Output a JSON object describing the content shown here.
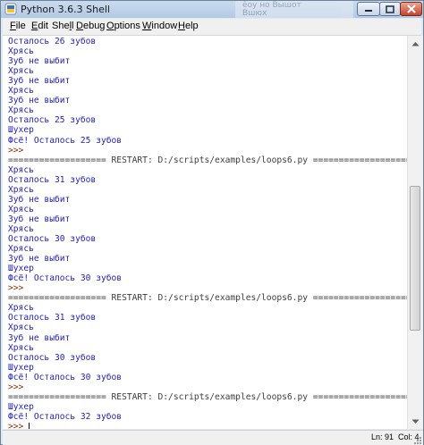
{
  "window": {
    "title": "Python 3.6.3 Shell",
    "background_window_text": [
      "ёоу но Вышот",
      "Вшюх"
    ]
  },
  "menu": {
    "items": [
      {
        "label": "File",
        "underline": "F",
        "rest": "ile"
      },
      {
        "label": "Edit",
        "underline": "E",
        "rest": "dit"
      },
      {
        "label": "Shell",
        "underline": "",
        "pre": "She",
        "underline_mid": "l",
        "rest": "l"
      },
      {
        "label": "Debug",
        "underline": "D",
        "rest": "ebug"
      },
      {
        "label": "Options",
        "underline": "O",
        "rest": "ptions"
      },
      {
        "label": "Window",
        "underline": "W",
        "rest": "indow"
      },
      {
        "label": "Help",
        "underline": "H",
        "rest": "elp"
      }
    ]
  },
  "shell": {
    "lines": [
      {
        "text": "Осталось 26 зубов",
        "kind": "out"
      },
      {
        "text": "Хрясь",
        "kind": "out"
      },
      {
        "text": "Зуб не выбит",
        "kind": "out"
      },
      {
        "text": "Хрясь",
        "kind": "out"
      },
      {
        "text": "Зуб не выбит",
        "kind": "out"
      },
      {
        "text": "Хрясь",
        "kind": "out"
      },
      {
        "text": "Зуб не выбит",
        "kind": "out"
      },
      {
        "text": "Хрясь",
        "kind": "out"
      },
      {
        "text": "Осталось 25 зубов",
        "kind": "out"
      },
      {
        "text": "Шухер",
        "kind": "out"
      },
      {
        "text": "Фсё! Осталось 25 зубов",
        "kind": "out"
      },
      {
        "text": ">>>",
        "kind": "prompt"
      },
      {
        "text": "=================== RESTART: D:/scripts/examples/loops6.py ===================",
        "kind": "restart"
      },
      {
        "text": "Хрясь",
        "kind": "out"
      },
      {
        "text": "Осталось 31 зубов",
        "kind": "out"
      },
      {
        "text": "Хрясь",
        "kind": "out"
      },
      {
        "text": "Зуб не выбит",
        "kind": "out"
      },
      {
        "text": "Хрясь",
        "kind": "out"
      },
      {
        "text": "Зуб не выбит",
        "kind": "out"
      },
      {
        "text": "Хрясь",
        "kind": "out"
      },
      {
        "text": "Осталось 30 зубов",
        "kind": "out"
      },
      {
        "text": "Хрясь",
        "kind": "out"
      },
      {
        "text": "Зуб не выбит",
        "kind": "out"
      },
      {
        "text": "Шухер",
        "kind": "out"
      },
      {
        "text": "Фсё! Осталось 30 зубов",
        "kind": "out"
      },
      {
        "text": ">>>",
        "kind": "prompt"
      },
      {
        "text": "=================== RESTART: D:/scripts/examples/loops6.py ===================",
        "kind": "restart"
      },
      {
        "text": "Хрясь",
        "kind": "out"
      },
      {
        "text": "Осталось 31 зубов",
        "kind": "out"
      },
      {
        "text": "Хрясь",
        "kind": "out"
      },
      {
        "text": "Зуб не выбит",
        "kind": "out"
      },
      {
        "text": "Хрясь",
        "kind": "out"
      },
      {
        "text": "Осталось 30 зубов",
        "kind": "out"
      },
      {
        "text": "Шухер",
        "kind": "out"
      },
      {
        "text": "Фсё! Осталось 30 зубов",
        "kind": "out"
      },
      {
        "text": ">>>",
        "kind": "prompt"
      },
      {
        "text": "=================== RESTART: D:/scripts/examples/loops6.py ===================",
        "kind": "restart"
      },
      {
        "text": "Шухер",
        "kind": "out"
      },
      {
        "text": "Фсё! Осталось 32 зубов",
        "kind": "out"
      },
      {
        "text": ">>>",
        "kind": "prompt",
        "cursor": true
      }
    ]
  },
  "status": {
    "line": "Ln: 91",
    "col": "Col: 4"
  },
  "colors": {
    "output": "#1f1fb8",
    "prompt": "#8a2a00",
    "restart": "#3d3d3d"
  },
  "icons": {
    "app": "python-idle-icon",
    "minimize": "minimize-icon",
    "maximize": "maximize-icon",
    "close": "close-icon",
    "scroll_up": "scroll-up-arrow-icon",
    "scroll_down": "scroll-down-arrow-icon",
    "resize": "resize-grip-icon"
  },
  "scroll": {
    "position_fraction": 0.62,
    "visible_fraction": 0.4
  }
}
